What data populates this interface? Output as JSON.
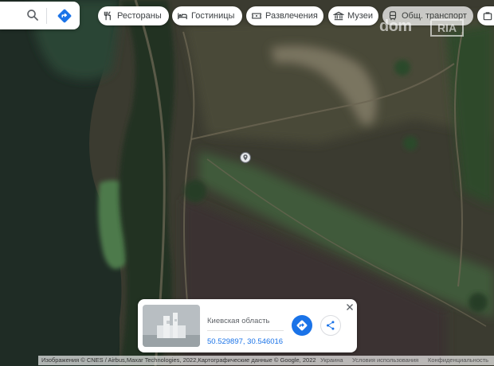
{
  "toolbar": {
    "search_icon": "search-icon",
    "directions_icon": "directions-icon"
  },
  "chips": [
    {
      "label": "Рестораны",
      "icon": "restaurant-icon"
    },
    {
      "label": "Гостиницы",
      "icon": "hotel-icon"
    },
    {
      "label": "Развлечения",
      "icon": "ticket-icon"
    },
    {
      "label": "Музеи",
      "icon": "museum-icon"
    },
    {
      "label": "Общ. транспорт",
      "icon": "transit-icon"
    }
  ],
  "watermark": {
    "part1": "dom",
    "part2": "RIA"
  },
  "place_card": {
    "region": "Киевская область",
    "coordinates": "50.529897, 30.546016"
  },
  "attribution": {
    "imagery": "Изображения © CNES / Airbus,Maxar Technologies, 2022,Картографические данные © Google, 2022",
    "country": "Украина",
    "terms": "Условия использования",
    "privacy": "Конфиденциальность"
  },
  "colors": {
    "accent": "#1a73e8",
    "water": "#1e2b24",
    "field": "#3a3a2e"
  }
}
